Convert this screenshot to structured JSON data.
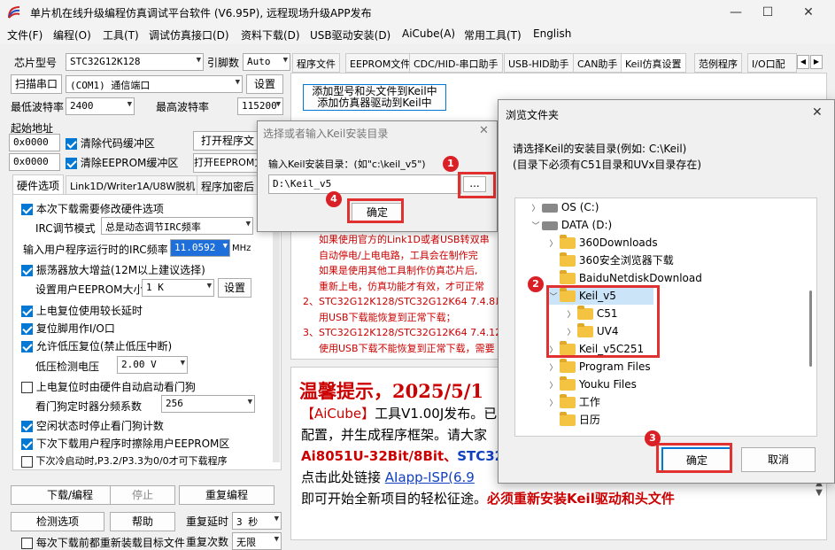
{
  "app": {
    "title": "单片机在线升级编程仿真调试平台软件 (V6.95P), 远程现场升级APP发布",
    "window_buttons": [
      "—",
      "☐",
      "✕"
    ]
  },
  "menu": [
    "文件(F)",
    "编程(O)",
    "工具(T)",
    "调试仿真接口(D)",
    "资料下载(D)",
    "USB驱动安装(D)",
    "AiCube(A)",
    "常用工具(T)",
    "English"
  ],
  "left": {
    "chip_label": "芯片型号",
    "chip_value": "STC32G12K128",
    "pin_label": "引脚数",
    "pin_value": "Auto",
    "scan_btn": "扫描串口",
    "port_value": "(COM1) 通信端口",
    "settings_btn": "设置",
    "min_baud_label": "最低波特率",
    "min_baud": "2400",
    "max_baud_label": "最高波特率",
    "max_baud": "115200",
    "start_addr_label": "起始地址",
    "addr1": "0x0000",
    "clear_code": "清除代码缓冲区",
    "open_prog": "打开程序文",
    "addr2": "0x0000",
    "clear_eeprom": "清除EEPROM缓冲区",
    "open_eeprom": "打开EEPROM文",
    "sub_tabs": [
      "硬件选项",
      "Link1D/Writer1A/U8W脱机",
      "程序加密后"
    ],
    "opt1": "本次下载需要修改硬件选项",
    "irc_mode_label": "IRC调节模式",
    "irc_mode": "总是动态调节IRC频率",
    "irc_freq_label": "输入用户程序运行时的IRC频率",
    "irc_freq": "11.0592",
    "mhz": "MHz",
    "opt_amp": "振荡器放大增益(12M以上建议选择)",
    "eeprom_size_label": "设置用户EEPROM大小",
    "eeprom_size": "1   K",
    "eeprom_set_btn": "设置",
    "opt_delay": "上电复位使用较长延时",
    "opt_reset_io": "复位脚用作I/O口",
    "opt_lvd": "允许低压复位(禁止低压中断)",
    "lvd_label": "低压检测电压",
    "lvd_value": "2.00 V",
    "opt_wdt": "上电复位时由硬件自动启动看门狗",
    "wdt_label": "看门狗定时器分频系数",
    "wdt_value": "256",
    "opt_idle": "空闲状态时停止看门狗计数",
    "opt_erase": "下次下载用户程序时擦除用户EEPROM区",
    "opt_p32": "下次冷启动时,P3.2/P3.3为0/0才可下载程序",
    "btn_download": "下载/编程",
    "btn_stop": "停止",
    "btn_reprog": "重复编程",
    "btn_check": "检测选项",
    "btn_help": "帮助",
    "repeat_delay_label": "重复延时",
    "repeat_delay": "3 秒",
    "repeat_count_label": "重复次数",
    "repeat_count": "无限",
    "last_line": "每次下载前都重新装载目标文件"
  },
  "right": {
    "tabs": [
      "程序文件",
      "EEPROM文件",
      "CDC/HID-串口助手",
      "USB-HID助手",
      "CAN助手",
      "Keil仿真设置",
      "范例程序",
      "I/O口配"
    ],
    "add_btn": "添加型号和头文件到Keil中",
    "add_btn2": "添加仿真器驱动到Keil中",
    "red_lines": [
      "如果使用官方的Link1D或者USB转双串",
      "自动停电/上电电路，工具会在制作完",
      "如果是使用其他工具制作仿真芯片后,",
      "重新上电，仿真功能才有效，才可正常",
      "2、STC32G12K128/STC32G12K64  7.4.8以上",
      "用USB下载能恢复到正常下载；",
      "3、STC32G12K128/STC32G12K64  7.4.12/",
      "使用USB下载不能恢复到正常下载，需要"
    ],
    "tip_title": "温馨提示，2025/5/1",
    "tip_l1a": "【AiCube】",
    "tip_l1b": "工具V1.00J发布。已",
    "tip_l2": "配置，并生成程序框架。请大家",
    "tip_l3a": "Ai8051U-32Bit/8Bit、",
    "tip_l3b": "STC32",
    "tip_l4a": "点击此处链接 ",
    "tip_l4b": "AIapp-ISP(6.9",
    "tip_l5a": "即可开始全新项目的轻松征途。",
    "tip_l5b": "必须重新安装Keil驱动和头文件"
  },
  "dlg1": {
    "title": "选择或者输入Keil安装目录",
    "label": "输入Keil安装目录：(如\"c:\\keil_v5\")",
    "path": "D:\\Keil_v5",
    "browse": "...",
    "ok": "确定",
    "close": "✕"
  },
  "dlg2": {
    "title": "浏览文件夹",
    "desc1": "请选择Keil的安装目录(例如: C:\\Keil)",
    "desc2": "(目录下必须有C51目录和UVx目录存在)",
    "tree": [
      "OS (C:)",
      "DATA (D:)",
      "360Downloads",
      "360安全浏览器下载",
      "BaiduNetdiskDownload",
      "Keil_v5",
      "C51",
      "UV4",
      "Keil_v5C251",
      "Program Files",
      "Youku Files",
      "工作",
      "日历"
    ],
    "ok": "确定",
    "cancel": "取消",
    "close": "✕"
  },
  "badges": [
    "1",
    "2",
    "3",
    "4"
  ]
}
